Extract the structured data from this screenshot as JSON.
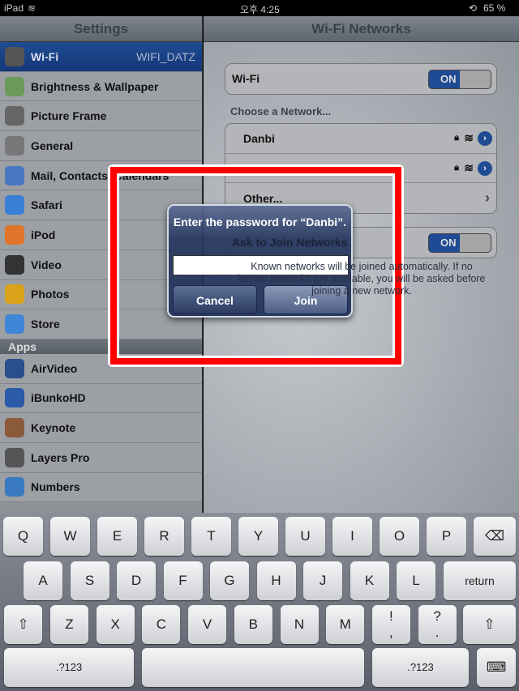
{
  "status": {
    "device": "iPad",
    "time": "오후 4:25",
    "battery": "65 %"
  },
  "sidebar": {
    "title": "Settings",
    "items": [
      {
        "label": "Wi-Fi",
        "value": "WIFI_DATZ",
        "icon": "wifi-icon",
        "color": "#555"
      },
      {
        "label": "Brightness & Wallpaper",
        "icon": "flower-icon",
        "color": "#6a9a5a"
      },
      {
        "label": "Picture Frame",
        "icon": "picture-frame-icon",
        "color": "#666"
      },
      {
        "label": "General",
        "icon": "gear-icon",
        "color": "#777"
      },
      {
        "label": "Mail, Contacts, Calendars",
        "icon": "mail-icon",
        "color": "#4a78c0"
      },
      {
        "label": "Safari",
        "icon": "compass-icon",
        "color": "#3a80d8"
      },
      {
        "label": "iPod",
        "icon": "ipod-icon",
        "color": "#e0752a"
      },
      {
        "label": "Video",
        "icon": "video-icon",
        "color": "#333"
      },
      {
        "label": "Photos",
        "icon": "sunflower-icon",
        "color": "#d9a21a"
      },
      {
        "label": "Store",
        "icon": "store-icon",
        "color": "#3f86d6"
      }
    ],
    "apps_header": "Apps",
    "apps": [
      {
        "label": "AirVideo",
        "icon": "airvideo-icon",
        "color": "#2b4f8a"
      },
      {
        "label": "iBunkoHD",
        "icon": "book-icon",
        "color": "#2a5aa8"
      },
      {
        "label": "Keynote",
        "icon": "keynote-icon",
        "color": "#8a5a3a"
      },
      {
        "label": "Layers Pro",
        "icon": "brush-icon",
        "color": "#555"
      },
      {
        "label": "Numbers",
        "icon": "numbers-icon",
        "color": "#3a7ac0"
      }
    ]
  },
  "main": {
    "title": "Wi-Fi Networks",
    "wifi_label": "Wi-Fi",
    "wifi_toggle": "ON",
    "choose_label": "Choose a Network...",
    "networks": [
      {
        "name": "Danbi"
      },
      {
        "name": ""
      }
    ],
    "other": "Other...",
    "ask_label": "Ask to Join Networks",
    "ask_toggle": "ON",
    "footer": "Known networks will be joined automatically.  If no known networks are available, you will be asked before joining a new network."
  },
  "dialog": {
    "title": "Enter the password for “Danbi”.",
    "password": "",
    "cancel": "Cancel",
    "join": "Join"
  },
  "keyboard": {
    "row1": [
      "Q",
      "W",
      "E",
      "R",
      "T",
      "Y",
      "U",
      "I",
      "O",
      "P"
    ],
    "row2": [
      "A",
      "S",
      "D",
      "F",
      "G",
      "H",
      "J",
      "K",
      "L"
    ],
    "row3": [
      "Z",
      "X",
      "C",
      "V",
      "B",
      "N",
      "M",
      "!\n,",
      "?\n."
    ],
    "return": "return",
    "numbers": ".?123"
  },
  "colors": {
    "highlight": "#f00",
    "selection": "#2f6fd1"
  }
}
